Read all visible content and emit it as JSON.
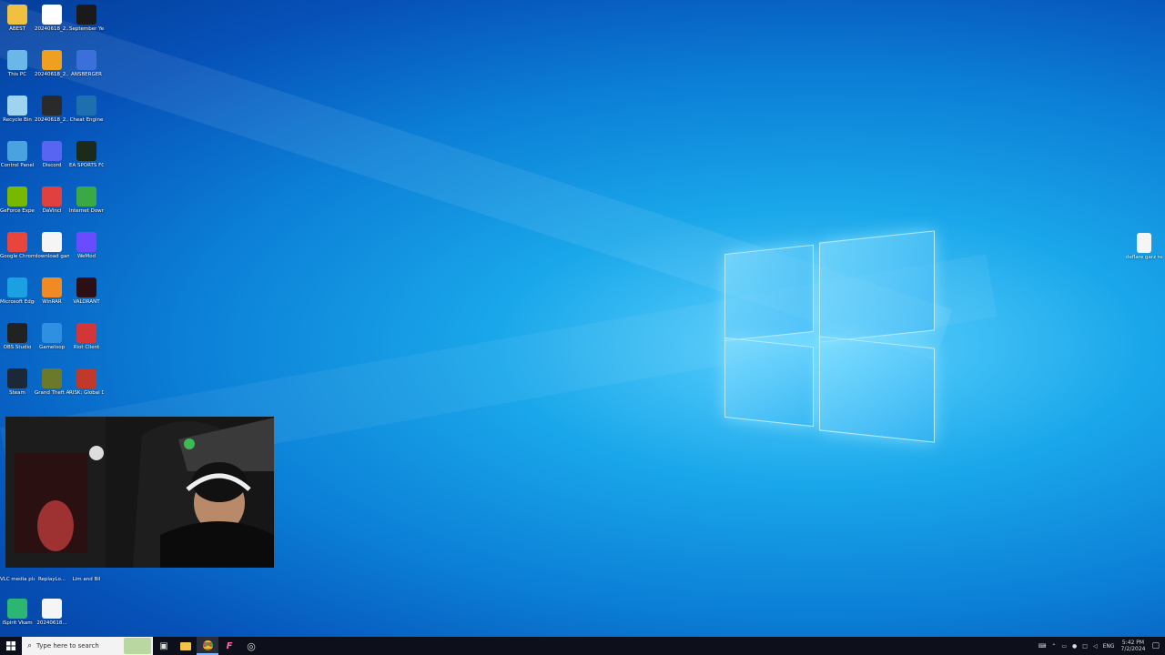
{
  "desktop_icons": [
    {
      "label": "ABEST",
      "color": "#f0c040"
    },
    {
      "label": "20240618_2...",
      "color": "#ffffff"
    },
    {
      "label": "September Ye...",
      "color": "#1a1a1a"
    },
    {
      "label": "This PC",
      "color": "#6ab7e8"
    },
    {
      "label": "20240618_2...",
      "color": "#f0a020"
    },
    {
      "label": "ANSBERGER",
      "color": "#3b6fd9"
    },
    {
      "label": "Recycle Bin",
      "color": "#9fd4f0"
    },
    {
      "label": "20240618_2...",
      "color": "#2a2a2a"
    },
    {
      "label": "Cheat Engine",
      "color": "#1e6fb0"
    },
    {
      "label": "Control Panel",
      "color": "#4aa3df"
    },
    {
      "label": "Discord",
      "color": "#5865f2"
    },
    {
      "label": "EA SPORTS FC™ 24",
      "color": "#1c2a1c"
    },
    {
      "label": "GeForce Experience",
      "color": "#76b900"
    },
    {
      "label": "DaVinci",
      "color": "#e04040"
    },
    {
      "label": "Internet Downlo...",
      "color": "#3aa845"
    },
    {
      "label": "Google Chrome",
      "color": "#e8453c"
    },
    {
      "label": "download gamerpic...",
      "color": "#f5f5f5"
    },
    {
      "label": "WeMod",
      "color": "#6a4cff"
    },
    {
      "label": "Microsoft Edge",
      "color": "#1ba1e2"
    },
    {
      "label": "WinRAR",
      "color": "#f08a24"
    },
    {
      "label": "VALORANT",
      "color": "#2b0f14"
    },
    {
      "label": "OBS Studio",
      "color": "#222222"
    },
    {
      "label": "Gameloop",
      "color": "#2f8fe0"
    },
    {
      "label": "Riot Client",
      "color": "#d13639"
    },
    {
      "label": "Steam",
      "color": "#1b2838"
    },
    {
      "label": "Grand Theft Auto V",
      "color": "#6a7a2a"
    },
    {
      "label": "RISK: Global Domination",
      "color": "#c0392b"
    }
  ],
  "bottom_icons": [
    {
      "label": "VLC media player"
    },
    {
      "label": "ReplayLo..."
    },
    {
      "label": "Lim and Bil"
    },
    {
      "label": "iSpirit Vkam"
    },
    {
      "label": "20240618..."
    }
  ],
  "right_icon": {
    "label": "deflare garz ne szabit"
  },
  "taskbar": {
    "search_placeholder": "Type here to search",
    "lang": "ENG",
    "time": "5:42 PM",
    "date": "7/2/2024"
  }
}
